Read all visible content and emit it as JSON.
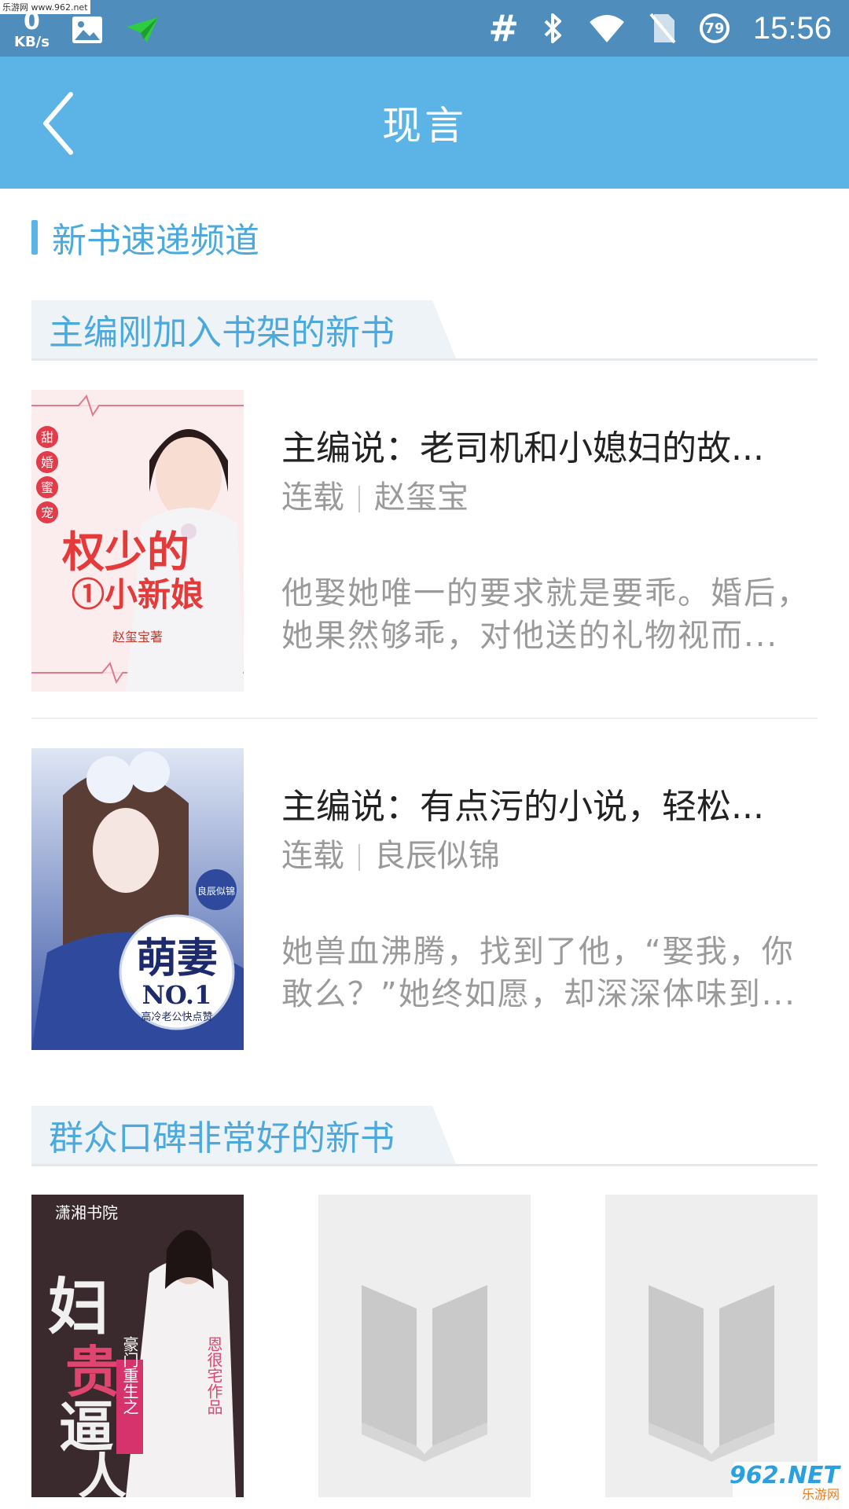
{
  "watermark_top": "乐游网 www.962.net",
  "status_bar": {
    "speed_value": "0",
    "speed_unit": "KB/s",
    "hash_symbol": "#",
    "battery_level": "79",
    "time": "15:56",
    "icons": [
      "gallery-icon",
      "send-icon",
      "bluetooth-icon",
      "wifi-icon",
      "no-sim-icon"
    ]
  },
  "header": {
    "title": "现言",
    "back_icon": "chevron-left-icon"
  },
  "channel": {
    "label": "新书速递频道"
  },
  "sections": [
    {
      "label": "主编刚加入书架的新书",
      "books": [
        {
          "title": "主编说：老司机和小媳妇的故...",
          "status": "连载",
          "author": "赵玺宝",
          "desc_line1": "他娶她唯一的要求就是要乖。婚后，",
          "desc_line2": "她果然够乖，对他送的礼物视而...",
          "cover_text_main": "权少的",
          "cover_text_sub": "①小新娘",
          "cover_text_series": "甜婚蜜宠",
          "cover_text_author": "赵玺宝著"
        },
        {
          "title": "主编说：有点污的小说，轻松...",
          "status": "连载",
          "author": "良辰似锦",
          "desc_line1": "她兽血沸腾，找到了他，“娶我，你",
          "desc_line2": "敢么？”她终如愿，却深深体味到...",
          "cover_text_main": "萌妻",
          "cover_text_sub": "NO.1",
          "cover_text_tag": "高冷老公快点赞",
          "cover_text_author": "良辰似锦"
        }
      ]
    },
    {
      "label": "群众口碑非常好的新书",
      "grid": [
        {
          "type": "cover",
          "cover_text_main": "妇贵逼人",
          "cover_text_sub": "豪门重生之",
          "cover_text_author": "恩很宅作品",
          "cover_text_publisher": "潇湘书院"
        },
        {
          "type": "placeholder",
          "icon": "book-placeholder-icon"
        },
        {
          "type": "placeholder",
          "icon": "book-placeholder-icon"
        }
      ]
    }
  ],
  "watermark_bottom": {
    "brand": "962.NET",
    "brand_sub": "乐游网"
  },
  "colors": {
    "status_bar": "#4f8ebc",
    "title_bar": "#5bb4e5",
    "accent_text": "#4ba9de",
    "muted_text": "#9a9a9a"
  }
}
